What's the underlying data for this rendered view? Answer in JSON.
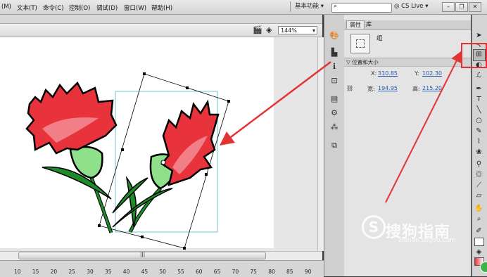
{
  "menubar": {
    "items": [
      "(M)",
      "文本(T)",
      "命令(C)",
      "控制(O)",
      "调试(D)",
      "窗口(W)",
      "帮助(H)"
    ],
    "workspace": "基本功能",
    "cs_live": "CS Live"
  },
  "stage": {
    "zoom": "144%"
  },
  "timeline": {
    "ticks": [
      "10",
      "15",
      "20",
      "25",
      "30",
      "35",
      "40",
      "45",
      "50",
      "55",
      "60",
      "65",
      "70",
      "75",
      "80",
      "85",
      "90"
    ]
  },
  "panel": {
    "tab_properties": "属性",
    "tab_library": "库",
    "instance_name": "组",
    "section_position": "位置和大小",
    "x_label": "X:",
    "x_value": "310.85",
    "y_label": "Y:",
    "y_value": "102.30",
    "w_label": "宽:",
    "w_value": "194.95",
    "h_label": "高:",
    "h_value": "215.20"
  },
  "watermark": {
    "text": "搜狗指南",
    "url": "zhinan.sogou.com",
    "logo": "S"
  },
  "colors": {
    "annotation": "#e53333",
    "petal": "#e8323c",
    "stem": "#1f8a2a"
  }
}
